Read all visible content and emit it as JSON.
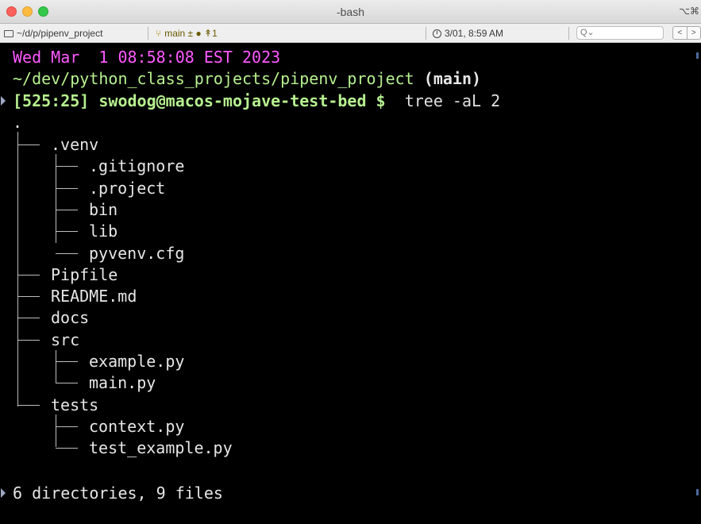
{
  "window": {
    "title": "-bash",
    "shortcut": "⌥⌘"
  },
  "statusbar": {
    "path": "~/d/p/pipenv_project",
    "git": "main ± ● ↟1",
    "clock": "3/01, 8:59 AM",
    "search_placeholder": "Q⌄",
    "nav_back": "<",
    "nav_forward": ">"
  },
  "terminal": {
    "date_line": "Wed Mar  1 08:58:08 EST 2023",
    "cwd": "~/dev/python_class_projects/pipenv_project",
    "branch": "(main)",
    "prompt": "[525:25] swodog@macos-mojave-test-bed $",
    "command": "tree -aL 2",
    "tree_root": ".",
    "tree_entries": [
      ".venv",
      ".gitignore",
      ".project",
      "bin",
      "lib",
      "pyvenv.cfg",
      "Pipfile",
      "README.md",
      "docs",
      "src",
      "example.py",
      "main.py",
      "tests",
      "context.py",
      "test_example.py"
    ],
    "summary": "6 directories, 9 files"
  },
  "colors": {
    "date": "#ff59ff",
    "cwd": "#b6f08f",
    "background": "#000000",
    "text": "#e6e6e6"
  }
}
